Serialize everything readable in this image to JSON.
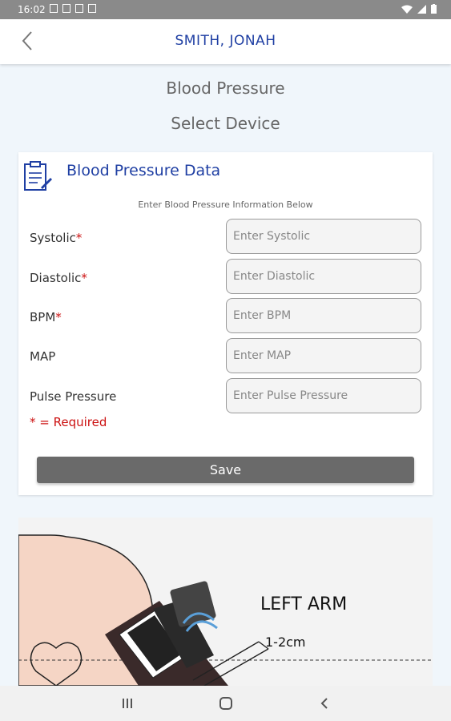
{
  "status_bar": {
    "time": "16:02"
  },
  "app_bar": {
    "patient_name": "SMITH, JONAH"
  },
  "page": {
    "heading": "Blood Pressure",
    "subheading": "Select Device"
  },
  "card": {
    "title": "Blood Pressure Data",
    "instruction": "Enter Blood Pressure Information Below",
    "fields": [
      {
        "label": "Systolic",
        "required": "*",
        "placeholder": "Enter Systolic",
        "value": ""
      },
      {
        "label": "Diastolic",
        "required": "*",
        "placeholder": "Enter Diastolic",
        "value": ""
      },
      {
        "label": "BPM",
        "required": "*",
        "placeholder": "Enter BPM",
        "value": ""
      },
      {
        "label": "MAP",
        "required": "",
        "placeholder": "Enter MAP",
        "value": ""
      },
      {
        "label": "Pulse Pressure",
        "required": "",
        "placeholder": "Enter Pulse Pressure",
        "value": ""
      }
    ],
    "required_note": "*  =  Required",
    "save_label": "Save"
  },
  "illustration": {
    "arm_label": "LEFT ARM",
    "distance_label": "1-2cm"
  },
  "icons": {
    "back": "chevron-left-icon",
    "clipboard": "clipboard-icon",
    "nav_recents": "recents-icon",
    "nav_home": "home-icon",
    "nav_back": "nav-back-icon"
  },
  "colors": {
    "accent": "#1f3fa3",
    "required": "#cc1111",
    "save_button": "#6a6a6a"
  }
}
